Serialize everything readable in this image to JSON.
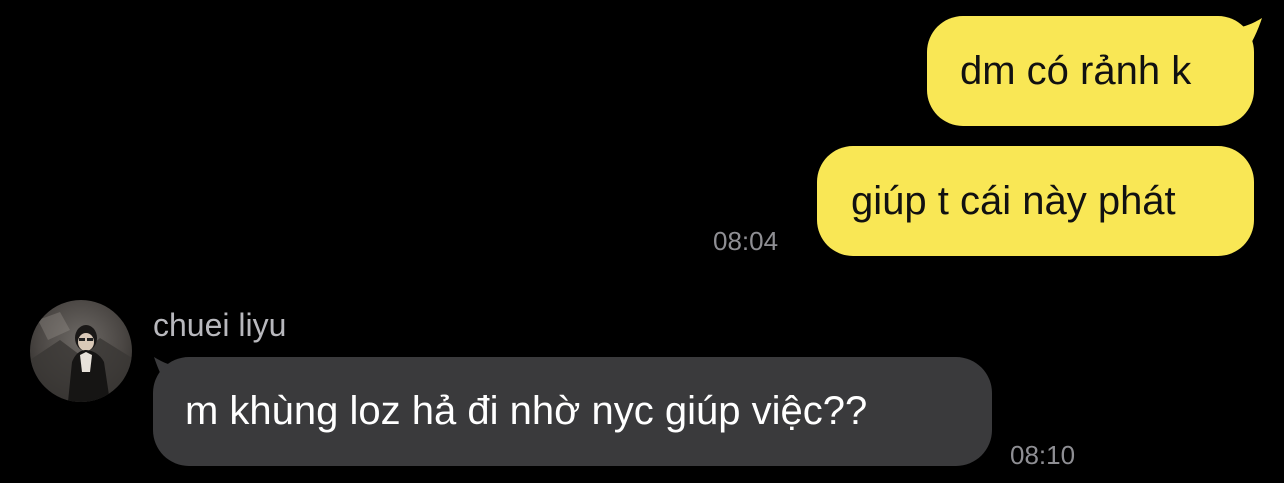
{
  "colors": {
    "background": "#000000",
    "outgoing_bubble": "#f9e755",
    "incoming_bubble": "#3a3a3c",
    "timestamp": "#8e8e93",
    "sender_name": "#b8b8bd"
  },
  "messages": {
    "outgoing": [
      {
        "text": "dm có rảnh k"
      },
      {
        "text": "giúp t cái này phát"
      }
    ],
    "outgoing_time": "08:04",
    "incoming": {
      "sender": "chuei liyu",
      "avatar_icon": "profile-photo-avatar",
      "text": "m khùng loz hả đi nhờ nyc giúp việc??",
      "time": "08:10"
    }
  }
}
